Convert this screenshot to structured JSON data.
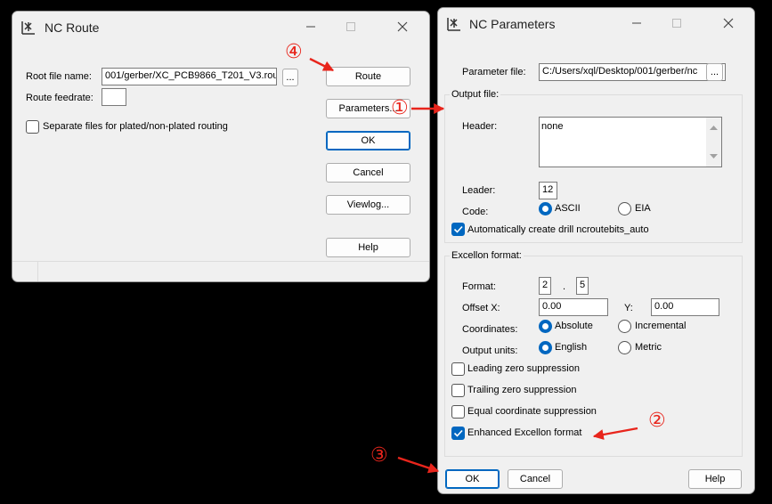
{
  "route_window": {
    "title": "NC Route",
    "root_label": "Root file name:",
    "root_value": "001/gerber/XC_PCB9866_T201_V3.rou",
    "browse_label": "...",
    "feedrate_label": "Route feedrate:",
    "feedrate_value": "",
    "separate_label": "Separate files for plated/non-plated routing",
    "buttons": {
      "route": "Route",
      "parameters": "Parameters...",
      "ok": "OK",
      "cancel": "Cancel",
      "viewlog": "Viewlog...",
      "help": "Help"
    }
  },
  "params_window": {
    "title": "NC Parameters",
    "param_file_label": "Parameter file:",
    "param_file_value": "C:/Users/xql/Desktop/001/gerber/nc",
    "browse_label": "...",
    "output_group": "Output file:",
    "header_label": "Header:",
    "header_value": "none",
    "leader_label": "Leader:",
    "leader_value": "12",
    "code_label": "Code:",
    "code_ascii": "ASCII",
    "code_eia": "EIA",
    "code_selected": "ASCII",
    "auto_drill_label": "Automatically create drill ncroutebits_auto",
    "auto_drill_checked": true,
    "excellon_group": "Excellon format:",
    "format_label": "Format:",
    "format_int": "2",
    "format_sep": ".",
    "format_dec": "5",
    "offset_x_label": "Offset X:",
    "offset_x_value": "0.00",
    "offset_y_label": "Y:",
    "offset_y_value": "0.00",
    "coords_label": "Coordinates:",
    "coords_absolute": "Absolute",
    "coords_incremental": "Incremental",
    "coords_selected": "Absolute",
    "units_label": "Output units:",
    "units_english": "English",
    "units_metric": "Metric",
    "units_selected": "English",
    "leading_zero": "Leading zero suppression",
    "trailing_zero": "Trailing zero suppression",
    "equal_coord": "Equal coordinate suppression",
    "enhanced": "Enhanced Excellon format",
    "enhanced_checked": true,
    "buttons": {
      "ok": "OK",
      "cancel": "Cancel",
      "help": "Help"
    }
  },
  "annotations": {
    "step1": "①",
    "step2": "②",
    "step3": "③",
    "step4": "④",
    "color": "#e8251c"
  },
  "accent_color": "#0067c0"
}
